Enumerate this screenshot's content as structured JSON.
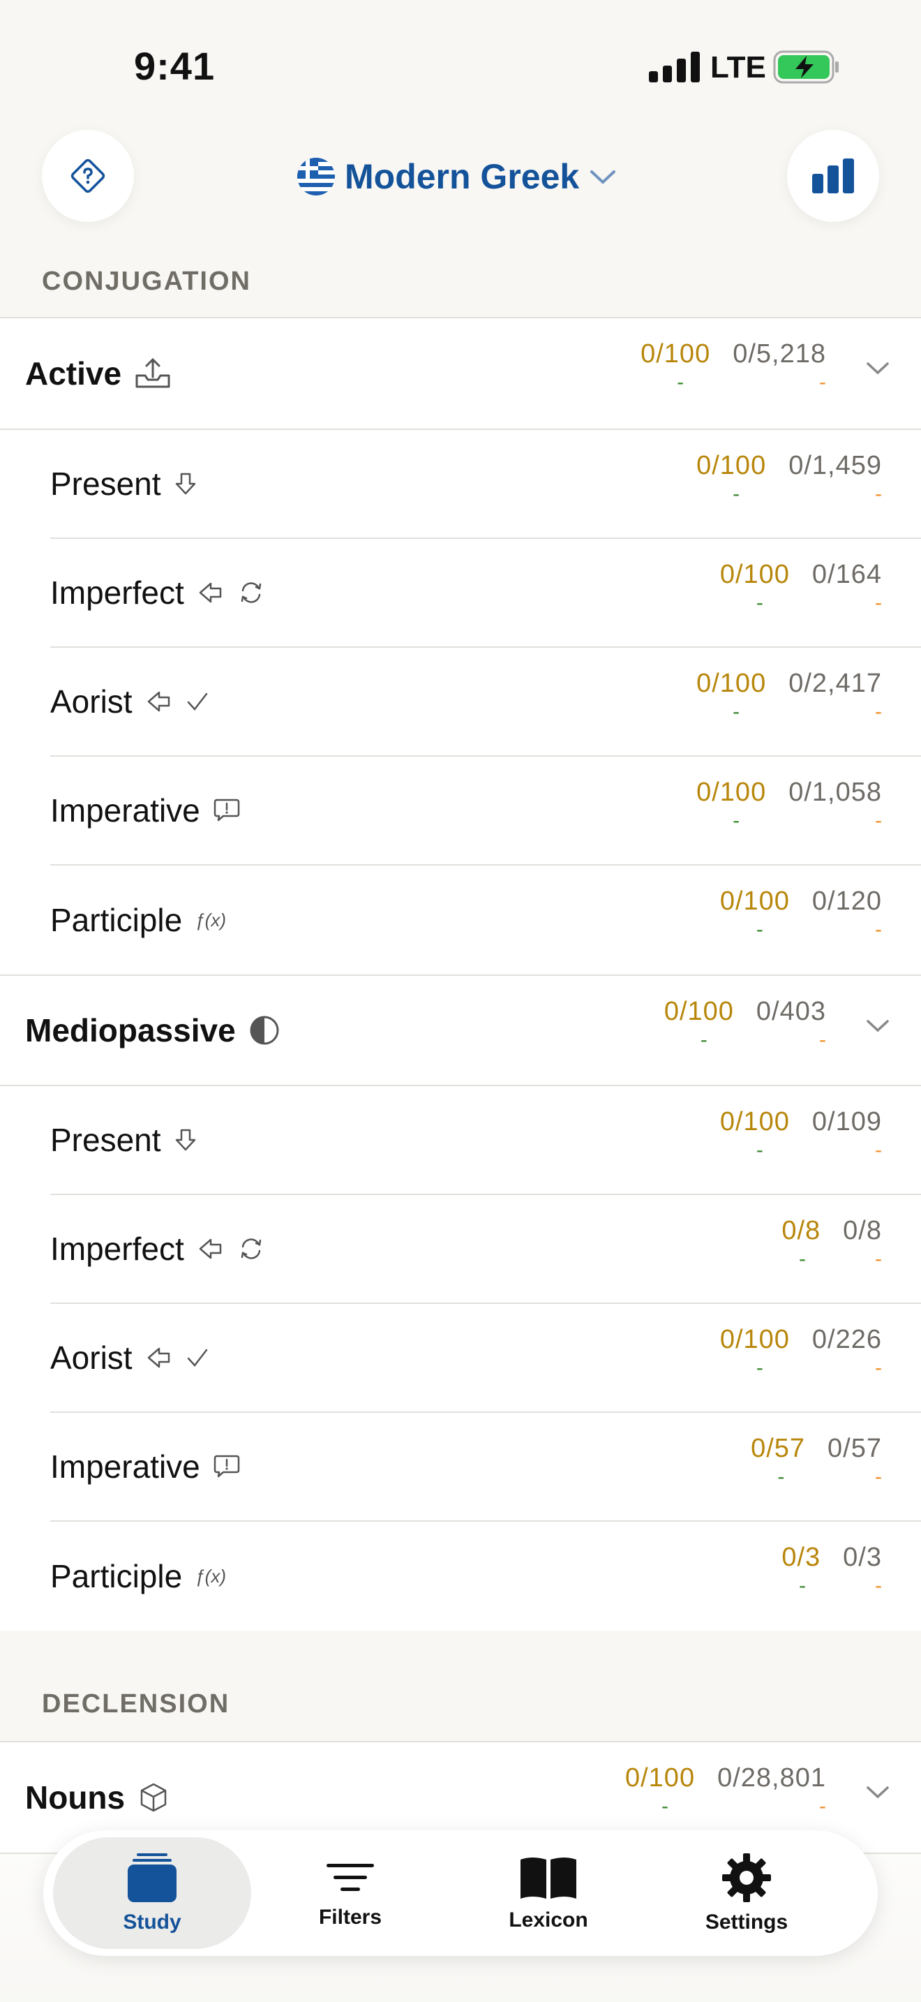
{
  "status_bar": {
    "time": "9:41",
    "network": "LTE"
  },
  "header": {
    "language": "Modern Greek"
  },
  "sections": {
    "conjugation": "CONJUGATION",
    "declension": "DECLENSION"
  },
  "conjugation": {
    "active": {
      "title": "Active",
      "learned": "0/100",
      "total": "0/5,218",
      "rows": [
        {
          "title": "Present",
          "learned": "0/100",
          "total": "0/1,459"
        },
        {
          "title": "Imperfect",
          "learned": "0/100",
          "total": "0/164"
        },
        {
          "title": "Aorist",
          "learned": "0/100",
          "total": "0/2,417"
        },
        {
          "title": "Imperative",
          "learned": "0/100",
          "total": "0/1,058"
        },
        {
          "title": "Participle",
          "learned": "0/100",
          "total": "0/120"
        }
      ]
    },
    "mediopassive": {
      "title": "Mediopassive",
      "learned": "0/100",
      "total": "0/403",
      "rows": [
        {
          "title": "Present",
          "learned": "0/100",
          "total": "0/109"
        },
        {
          "title": "Imperfect",
          "learned": "0/8",
          "total": "0/8"
        },
        {
          "title": "Aorist",
          "learned": "0/100",
          "total": "0/226"
        },
        {
          "title": "Imperative",
          "learned": "0/57",
          "total": "0/57"
        },
        {
          "title": "Participle",
          "learned": "0/3",
          "total": "0/3"
        }
      ]
    }
  },
  "declension": {
    "nouns": {
      "title": "Nouns",
      "learned": "0/100",
      "total": "0/28,801"
    }
  },
  "dash": "-",
  "function_glyph": "ƒ(x)",
  "tabs": [
    {
      "label": "Study"
    },
    {
      "label": "Filters"
    },
    {
      "label": "Lexicon"
    },
    {
      "label": "Settings"
    }
  ],
  "colors": {
    "accent": "#14539a",
    "learned": "#b8860b",
    "green": "#3a8a2e",
    "orange": "#f0902a"
  }
}
